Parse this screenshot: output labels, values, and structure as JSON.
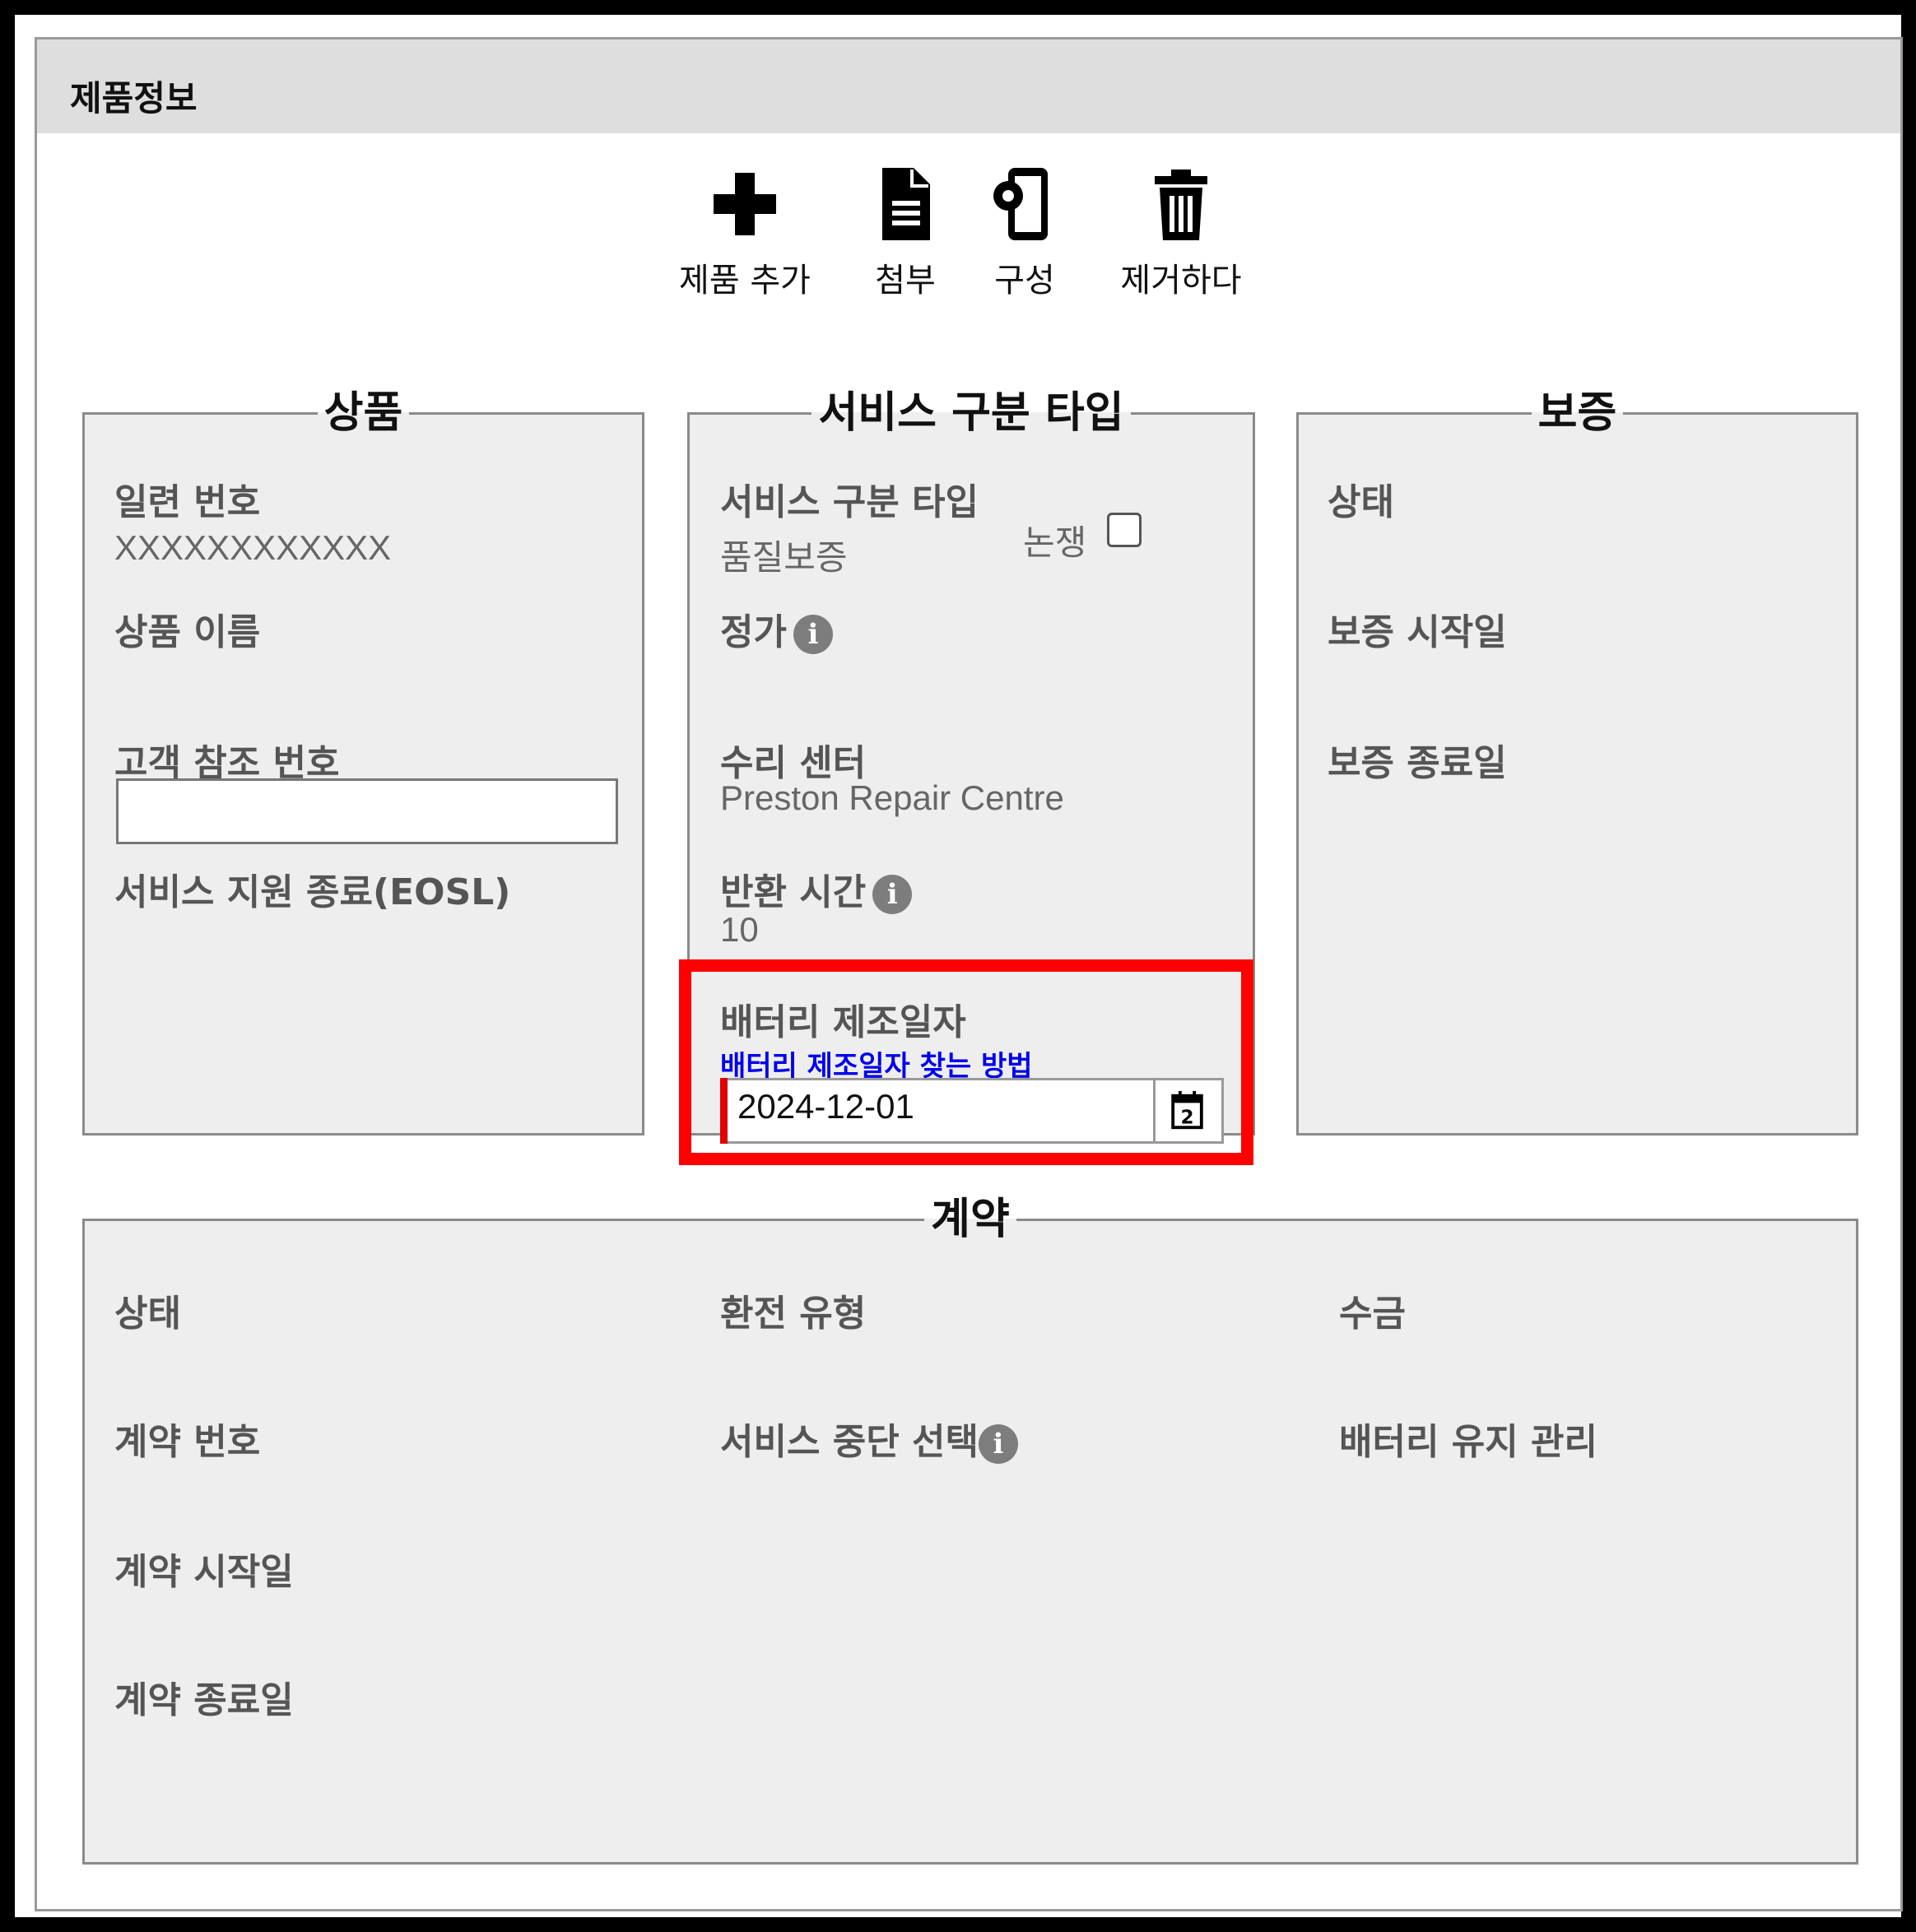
{
  "header": {
    "title": "제품정보"
  },
  "toolbar": {
    "add_label": "제품 추가",
    "attach_label": "첨부",
    "config_label": "구성",
    "remove_label": "제거하다"
  },
  "product": {
    "legend": "상품",
    "serial_label": "일련 번호",
    "serial_value": "XXXXXXXXXXXX",
    "name_label": "상품 이름",
    "customer_ref_label": "고객 참조 번호",
    "customer_ref_value": "",
    "eosl_label": "서비스 지원 종료(EOSL)"
  },
  "service": {
    "legend": "서비스 구분 타입",
    "type_label": "서비스 구분 타입",
    "type_value": "품질보증",
    "dispute_label": "논쟁",
    "price_label": "정가",
    "repair_center_label": "수리 센터",
    "repair_center_value": "Preston Repair Centre",
    "turnaround_label": "반환 시간",
    "turnaround_value": "10",
    "battery_date_label": "배터리 제조일자",
    "battery_help_link": "배터리 제조일자 찾는 방법",
    "battery_date_value": "2024-12-01",
    "calendar_day": "2"
  },
  "warranty": {
    "legend": "보증",
    "status_label": "상태",
    "start_label": "보증 시작일",
    "end_label": "보증 종료일"
  },
  "contract": {
    "legend": "계약",
    "status_label": "상태",
    "number_label": "계약 번호",
    "start_label": "계약 시작일",
    "end_label": "계약 종료일",
    "refund_type_label": "환전 유형",
    "service_stop_label": "서비스 중단 선택",
    "collection_label": "수금",
    "battery_maint_label": "배터리 유지 관리"
  },
  "colors": {
    "highlight": "#ff0000",
    "link": "#0000ee",
    "panel": "#eeeeee",
    "header": "#dedede"
  },
  "icons": [
    "plus-icon",
    "document-icon",
    "device-gear-icon",
    "trash-icon",
    "calendar-icon",
    "info-icon"
  ]
}
